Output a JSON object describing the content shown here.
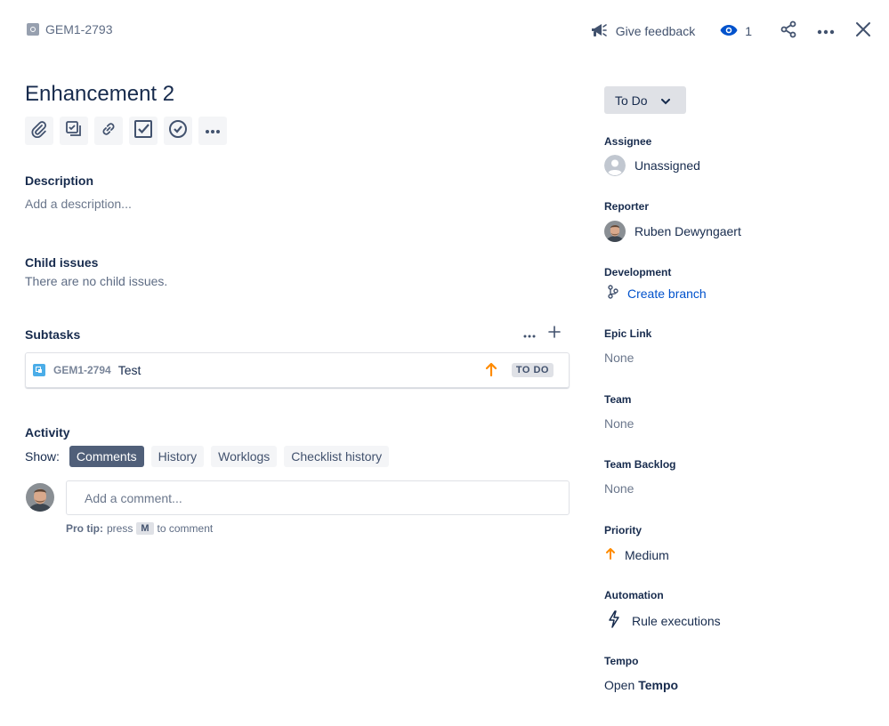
{
  "header": {
    "issue_key": "GEM1-2793",
    "feedback_label": "Give feedback",
    "watch_count": "1"
  },
  "issue": {
    "title": "Enhancement 2"
  },
  "toolbar": {
    "icons": [
      "paperclip-icon",
      "subtask-icon",
      "link-icon",
      "checklist-icon",
      "check-circle-icon",
      "more-icon"
    ]
  },
  "description": {
    "heading": "Description",
    "placeholder": "Add a description..."
  },
  "child_issues": {
    "heading": "Child issues",
    "empty_text": "There are no child issues."
  },
  "subtasks": {
    "heading": "Subtasks",
    "items": [
      {
        "key": "GEM1-2794",
        "summary": "Test",
        "status": "TO DO",
        "priority": "Medium"
      }
    ]
  },
  "activity": {
    "heading": "Activity",
    "show_label": "Show:",
    "tabs": [
      "Comments",
      "History",
      "Worklogs",
      "Checklist history"
    ],
    "active_tab": "Comments",
    "comment_placeholder": "Add a comment...",
    "pro_tip_label": "Pro tip:",
    "pro_tip_press": "press",
    "pro_tip_key": "M",
    "pro_tip_suffix": "to comment"
  },
  "sidebar": {
    "status": "To Do",
    "assignee_label": "Assignee",
    "assignee_value": "Unassigned",
    "reporter_label": "Reporter",
    "reporter_value": "Ruben Dewyngaert",
    "development_label": "Development",
    "development_value": "Create branch",
    "epic_link_label": "Epic Link",
    "epic_link_value": "None",
    "team_label": "Team",
    "team_value": "None",
    "team_backlog_label": "Team Backlog",
    "team_backlog_value": "None",
    "priority_label": "Priority",
    "priority_value": "Medium",
    "automation_label": "Automation",
    "automation_value": "Rule executions",
    "tempo_label": "Tempo",
    "tempo_open": "Open",
    "tempo_brand": "Tempo"
  },
  "colors": {
    "link": "#0052CC",
    "priority_medium": "#FF8B00",
    "active_tab": "#505F79",
    "subtask_icon": "#4BADE8"
  }
}
